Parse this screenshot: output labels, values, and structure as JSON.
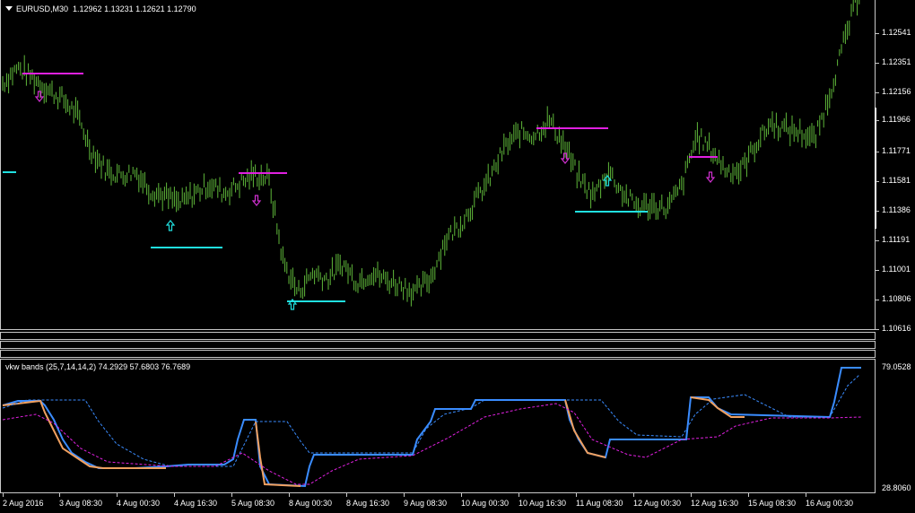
{
  "header": {
    "symbol_tf": "EURUSD,M30",
    "ohlc": "1.12962 1.13231 1.12621 1.12790"
  },
  "indicator": {
    "title": "vkw bands (25,7,14,14,2) 74.2929 57.6803 76.7689"
  },
  "price_axis": {
    "labels": [
      "1.12541",
      "1.12351",
      "1.12156",
      "1.11966",
      "1.11771",
      "1.11581",
      "1.11386",
      "1.11191",
      "1.11001",
      "1.10806",
      "1.10616"
    ],
    "min": 1.10616,
    "max": 1.12736
  },
  "indicator_axis": {
    "labels": [
      "79.0528",
      "28.8060"
    ],
    "min": 28.806,
    "max": 79.0528
  },
  "time_axis": {
    "labels": [
      "2 Aug 2016",
      "3 Aug 08:30",
      "4 Aug 00:30",
      "4 Aug 16:30",
      "5 Aug 08:30",
      "8 Aug 00:30",
      "8 Aug 16:30",
      "9 Aug 08:30",
      "10 Aug 00:30",
      "10 Aug 16:30",
      "11 Aug 08:30",
      "12 Aug 00:30",
      "12 Aug 16:30",
      "15 Aug 08:30",
      "16 Aug 00:30"
    ]
  },
  "colors": {
    "bars": "#5fb83a",
    "resistance": "#e020e0",
    "support": "#20e0e0",
    "up_arrow": "#20e0e0",
    "down_arrow": "#d030d0",
    "band_main": "#3a8cff",
    "band_alt": "#f0a060",
    "band_upper": "#3a8cff",
    "band_lower": "#e020e0"
  },
  "chart_data": [
    {
      "type": "candlestick",
      "symbol": "EURUSD",
      "timeframe": "M30",
      "close_path": [
        1.1222,
        1.1232,
        1.1226,
        1.1218,
        1.1212,
        1.1202,
        1.1178,
        1.1165,
        1.1162,
        1.1164,
        1.1152,
        1.1148,
        1.1143,
        1.115,
        1.1156,
        1.115,
        1.1156,
        1.1162,
        1.116,
        1.1105,
        1.1085,
        1.1098,
        1.1094,
        1.1104,
        1.1092,
        1.1098,
        1.1093,
        1.109,
        1.1085,
        1.1095,
        1.112,
        1.113,
        1.1145,
        1.116,
        1.118,
        1.119,
        1.1188,
        1.1198,
        1.1182,
        1.116,
        1.1148,
        1.1165,
        1.115,
        1.1141,
        1.1142,
        1.114,
        1.1155,
        1.1188,
        1.1178,
        1.1165,
        1.1165,
        1.1182,
        1.1196,
        1.1192,
        1.119,
        1.1185,
        1.1215,
        1.125,
        1.1282
      ],
      "resistance_lines": [
        1.1234,
        1.1165,
        1.119,
        1.1176
      ],
      "support_lines": [
        1.1136,
        1.1097,
        1.1144
      ],
      "signals": [
        "down",
        "up",
        "down",
        "up",
        "down",
        "up",
        "down"
      ]
    },
    {
      "type": "line",
      "name": "vkw bands (25,7,14,14,2)",
      "values": [
        74.2929,
        57.6803,
        76.7689
      ],
      "ylim": [
        28.806,
        79.0528
      ]
    }
  ]
}
